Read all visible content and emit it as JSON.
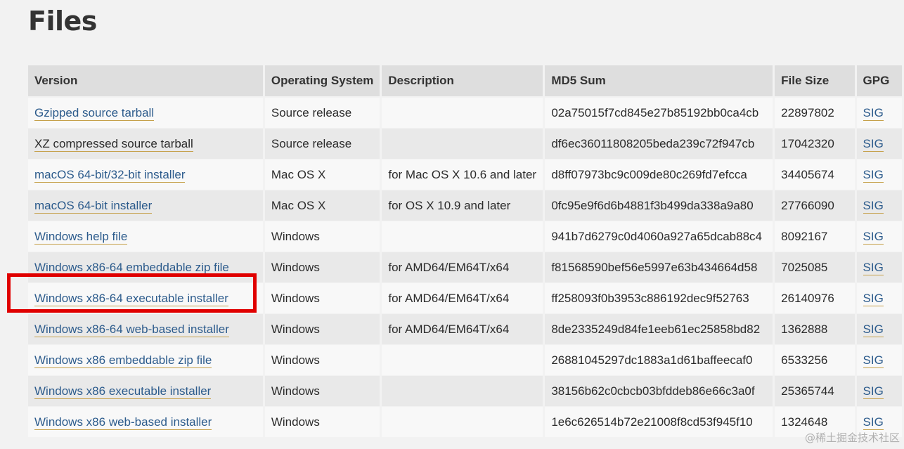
{
  "page": {
    "title": "Files"
  },
  "table": {
    "headers": [
      "Version",
      "Operating System",
      "Description",
      "MD5 Sum",
      "File Size",
      "GPG"
    ],
    "rows": [
      {
        "version": "Gzipped source tarball",
        "os": "Source release",
        "description": "",
        "md5": "02a75015f7cd845e27b85192bb0ca4cb",
        "size": "22897802",
        "gpg": "SIG"
      },
      {
        "version": "XZ compressed source tarball",
        "os": "Source release",
        "description": "",
        "md5": "df6ec36011808205beda239c72f947cb",
        "size": "17042320",
        "gpg": "SIG"
      },
      {
        "version": "macOS 64-bit/32-bit installer",
        "os": "Mac OS X",
        "description": "for Mac OS X 10.6 and later",
        "md5": "d8ff07973bc9c009de80c269fd7efcca",
        "size": "34405674",
        "gpg": "SIG"
      },
      {
        "version": "macOS 64-bit installer",
        "os": "Mac OS X",
        "description": "for OS X 10.9 and later",
        "md5": "0fc95e9f6d6b4881f3b499da338a9a80",
        "size": "27766090",
        "gpg": "SIG"
      },
      {
        "version": "Windows help file",
        "os": "Windows",
        "description": "",
        "md5": "941b7d6279c0d4060a927a65dcab88c4",
        "size": "8092167",
        "gpg": "SIG"
      },
      {
        "version": "Windows x86-64 embeddable zip file",
        "os": "Windows",
        "description": "for AMD64/EM64T/x64",
        "md5": "f81568590bef56e5997e63b434664d58",
        "size": "7025085",
        "gpg": "SIG"
      },
      {
        "version": "Windows x86-64 executable installer",
        "os": "Windows",
        "description": "for AMD64/EM64T/x64",
        "md5": "ff258093f0b3953c886192dec9f52763",
        "size": "26140976",
        "gpg": "SIG"
      },
      {
        "version": "Windows x86-64 web-based installer",
        "os": "Windows",
        "description": "for AMD64/EM64T/x64",
        "md5": "8de2335249d84fe1eeb61ec25858bd82",
        "size": "1362888",
        "gpg": "SIG"
      },
      {
        "version": "Windows x86 embeddable zip file",
        "os": "Windows",
        "description": "",
        "md5": "26881045297dc1883a1d61baffeecaf0",
        "size": "6533256",
        "gpg": "SIG"
      },
      {
        "version": "Windows x86 executable installer",
        "os": "Windows",
        "description": "",
        "md5": "38156b62c0cbcb03bfddeb86e66c3a0f",
        "size": "25365744",
        "gpg": "SIG"
      },
      {
        "version": "Windows x86 web-based installer",
        "os": "Windows",
        "description": "",
        "md5": "1e6c626514b72e21008f8cd53f945f10",
        "size": "1324648",
        "gpg": "SIG"
      }
    ]
  },
  "watermark": "@稀土掘金技术社区",
  "colors": {
    "link": "#2c5b8c",
    "link_underline": "#c5a04a",
    "highlight": "#e00000"
  }
}
